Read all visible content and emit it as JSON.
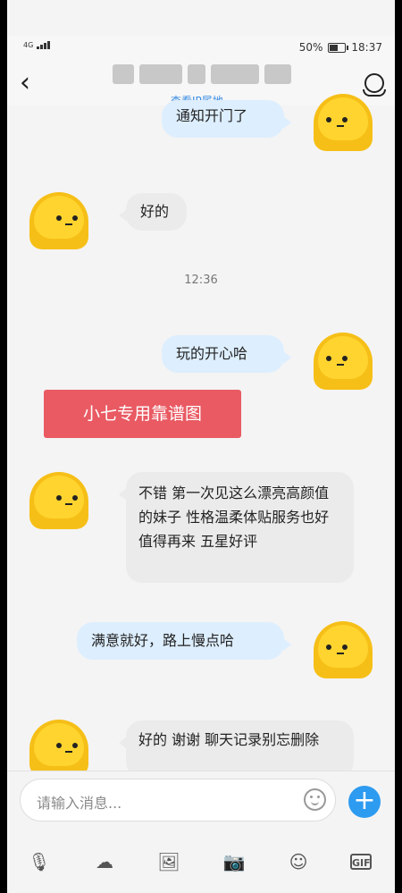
{
  "status": {
    "network": "4G",
    "battery": "50%",
    "time": "18:37"
  },
  "header": {
    "ip_label": "查看IP属地"
  },
  "messages": {
    "out1": "通知开门了",
    "in1": "好的",
    "time1": "12:36",
    "out2": "玩的开心哈",
    "red_button": "小七专用靠谱图",
    "in2": "不错 第一次见这么漂亮高颜值的妹子 性格温柔体贴服务也好 值得再来 五星好评",
    "out3": "满意就好，路上慢点哈",
    "in3": "好的 谢谢 聊天记录别忘删除"
  },
  "input": {
    "placeholder": "请输入消息..."
  },
  "icons": {
    "back": "chevron-left-icon",
    "profile": "profile-icon",
    "emoji": "emoji-icon",
    "plus": "plus-icon"
  },
  "toolbar": {
    "mic": "🎙",
    "cloud": "☁",
    "image": "🖼",
    "camera": "📷",
    "smile": "☺",
    "gif": "GIF"
  },
  "colors": {
    "accent": "#2d9bf0",
    "red_button": "#e95a63",
    "avatar": "#f6bf17"
  }
}
